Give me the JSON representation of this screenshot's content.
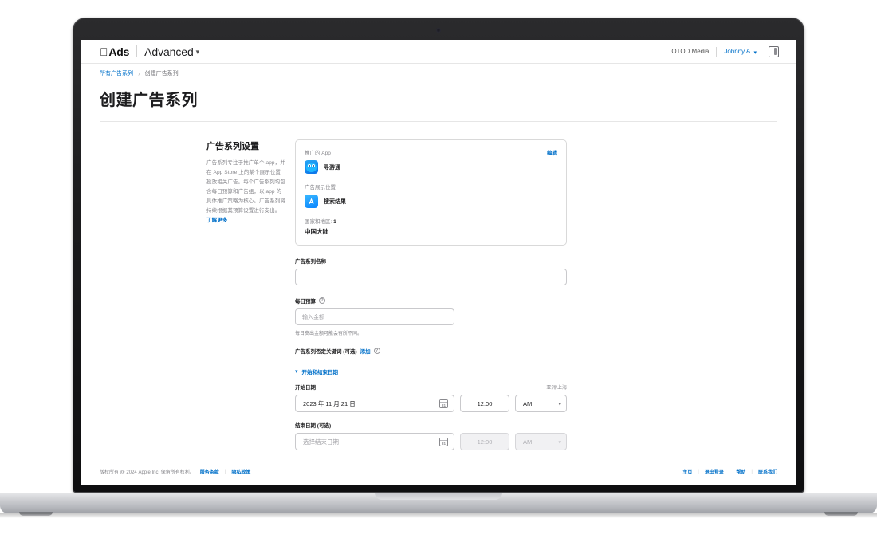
{
  "topbar": {
    "apple_logo": "apple-logo",
    "brand": "Ads",
    "product": "Advanced",
    "product_chevron": "chevron-down-icon",
    "account": "OTOD Media",
    "user": "Johnny A.",
    "user_chevron": "chevron-down-icon",
    "panel_icon": "side-panel-icon"
  },
  "breadcrumb": {
    "parent": "所有广告系列",
    "separator": "›",
    "current": "创建广告系列"
  },
  "page": {
    "title": "创建广告系列"
  },
  "section": {
    "title": "广告系列设置",
    "description": "广告系列专注于推广单个 app，并在 App Store 上的某个展示位置投放相关广告。每个广告系列均包含每日预算和广告组，以 app 的具体推广策略为核心。广告系列将持续根据其预算设置进行支出。",
    "learn_more": "了解更多"
  },
  "card": {
    "edit_label": "编辑",
    "app_label": "推广的 App",
    "app_name": "寻游通",
    "app_icon": "app-icon-tour-guide",
    "placement_label": "广告展示位置",
    "placement_value": "搜索结果",
    "placement_icon": "app-store-icon",
    "countries_label": "国家和地区:",
    "countries_count": "1",
    "countries_value": "中国大陆"
  },
  "form": {
    "campaign_name_label": "广告系列名称",
    "campaign_name_value": "",
    "campaign_name_placeholder": "",
    "daily_budget_label": "每日预算",
    "daily_budget_help_icon": "help-icon",
    "daily_budget_placeholder": "输入金额",
    "daily_budget_value": "",
    "daily_budget_hint": "每日支出金额可能会有所不同。",
    "negative_keywords_label": "广告系列否定关键词 (可选)",
    "negative_keywords_add": "添加",
    "negative_keywords_help_icon": "help-icon"
  },
  "dates": {
    "disclosure_icon": "chevron-down-icon",
    "disclosure_label": "开始和结束日期",
    "start_label": "开始日期",
    "timezone": "亚洲/上海",
    "start_date_value": "2023 年 11 月 21 日",
    "start_calendar_icon": "calendar-icon",
    "start_calendar_day": "31",
    "start_time_value": "12:00",
    "start_ampm_value": "AM",
    "end_label": "结束日期 (可选)",
    "end_date_placeholder": "选择结束日期",
    "end_calendar_icon": "calendar-icon",
    "end_calendar_day": "31",
    "end_time_value": "12:00",
    "end_ampm_value": "AM"
  },
  "footer": {
    "copyright": "版权所有 @ 2024 Apple Inc. 保留所有权利。",
    "terms": "服务条款",
    "privacy": "隐私政策",
    "home": "主页",
    "signout": "退出登录",
    "help": "帮助",
    "contact": "联系我们",
    "sep": "|"
  }
}
